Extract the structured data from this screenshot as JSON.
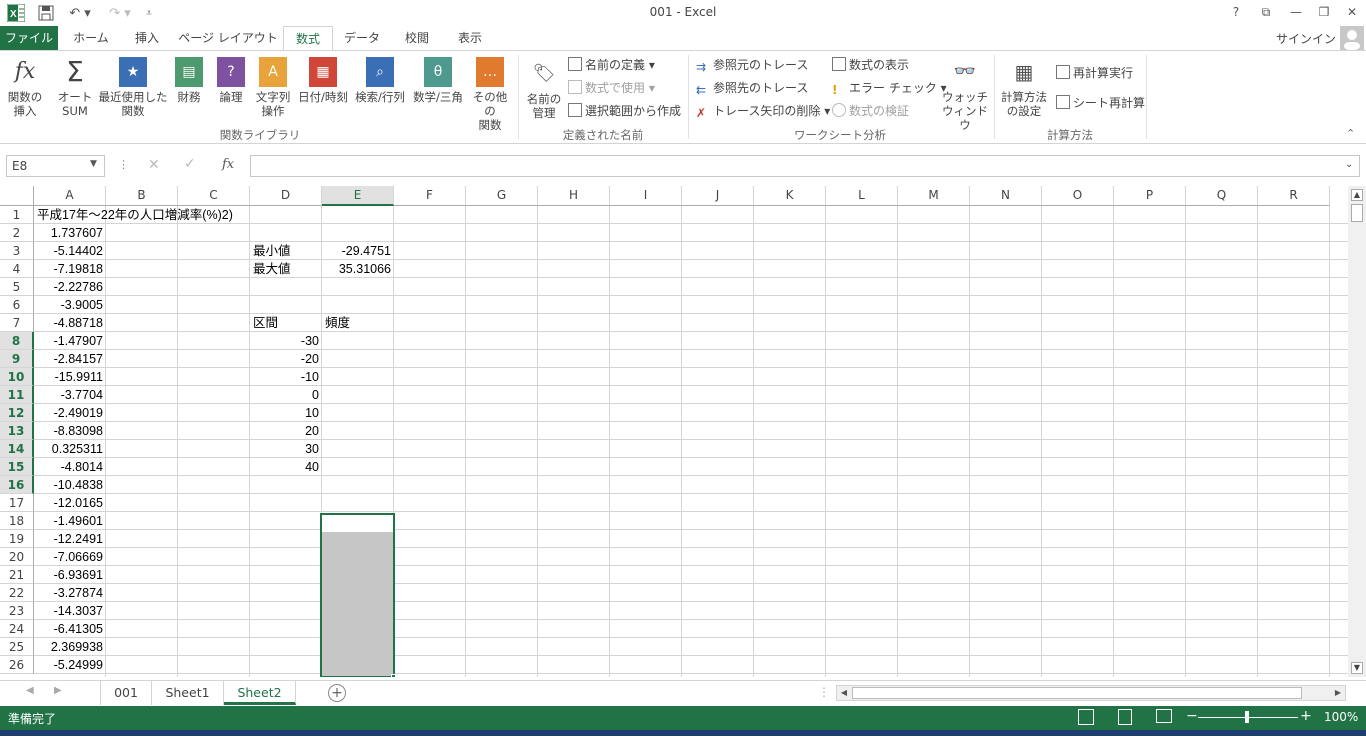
{
  "window": {
    "title": "001 - Excel",
    "help": "?",
    "signin": "サインイン"
  },
  "tabs": {
    "file": "ファイル",
    "home": "ホーム",
    "insert": "挿入",
    "pagelayout": "ページ レイアウト",
    "formulas": "数式",
    "data": "データ",
    "review": "校閲",
    "view": "表示"
  },
  "ribbon": {
    "insert_fn": [
      "関数の",
      "挿入"
    ],
    "autosum": [
      "オート",
      "SUM"
    ],
    "recent": [
      "最近使用した",
      "関数"
    ],
    "financial": "財務",
    "logical": "論理",
    "text": [
      "文字列",
      "操作"
    ],
    "datetime": "日付/時刻",
    "lookup": "検索/行列",
    "math": "数学/三角",
    "more": [
      "その他の",
      "関数"
    ],
    "group_library": "関数ライブラリ",
    "name_manager": [
      "名前の",
      "管理"
    ],
    "define_name": "名前の定義",
    "use_in_formula": "数式で使用",
    "create_from_selection": "選択範囲から作成",
    "group_names": "定義された名前",
    "trace_precedents": "参照元のトレース",
    "trace_dependents": "参照先のトレース",
    "remove_arrows": "トレース矢印の削除",
    "show_formulas": "数式の表示",
    "error_checking": "エラー チェック",
    "evaluate": "数式の検証",
    "watch": [
      "ウォッチ",
      "ウィンドウ"
    ],
    "group_audit": "ワークシート分析",
    "calc_options": [
      "計算方法",
      "の設定"
    ],
    "calc_now": "再計算実行",
    "calc_sheet": "シート再計算",
    "group_calc": "計算方法"
  },
  "formula_bar": {
    "namebox": "E8",
    "fx": "fx",
    "content": ""
  },
  "columns": [
    "A",
    "B",
    "C",
    "D",
    "E",
    "F",
    "G",
    "H",
    "I",
    "J",
    "K",
    "L",
    "M",
    "N",
    "O",
    "P",
    "Q",
    "R"
  ],
  "selected_column": "E",
  "rows": [
    "1",
    "2",
    "3",
    "4",
    "5",
    "6",
    "7",
    "8",
    "9",
    "10",
    "11",
    "12",
    "13",
    "14",
    "15",
    "16",
    "17",
    "18",
    "19",
    "20",
    "21",
    "22",
    "23",
    "24",
    "25",
    "26"
  ],
  "selected_rows": [
    8,
    9,
    10,
    11,
    12,
    13,
    14,
    15,
    16
  ],
  "cells": {
    "A1": "平成17年～22年の人口増減率(%)2)",
    "colA": [
      "",
      "1.737607",
      "-5.14402",
      "-7.19818",
      "-2.22786",
      "-3.9005",
      "-4.88718",
      "-1.47907",
      "-2.84157",
      "-15.9911",
      "-3.7704",
      "-2.49019",
      "-8.83098",
      "0.325311",
      "-4.8014",
      "-10.4838",
      "-12.0165",
      "-1.49601",
      "-12.2491",
      "-7.06669",
      "-6.93691",
      "-3.27874",
      "-14.3037",
      "-6.41305",
      "2.369938",
      "-5.24999"
    ],
    "D3": "最小値",
    "E3": "-29.4751",
    "D4": "最大値",
    "E4": "35.31066",
    "D7": "区間",
    "E7": "頻度",
    "colD_bins": [
      "-30",
      "-20",
      "-10",
      "0",
      "10",
      "20",
      "30",
      "40"
    ]
  },
  "sheets": [
    "001",
    "Sheet1",
    "Sheet2"
  ],
  "active_sheet": "Sheet2",
  "status": {
    "ready": "準備完了",
    "zoom": "100%"
  }
}
